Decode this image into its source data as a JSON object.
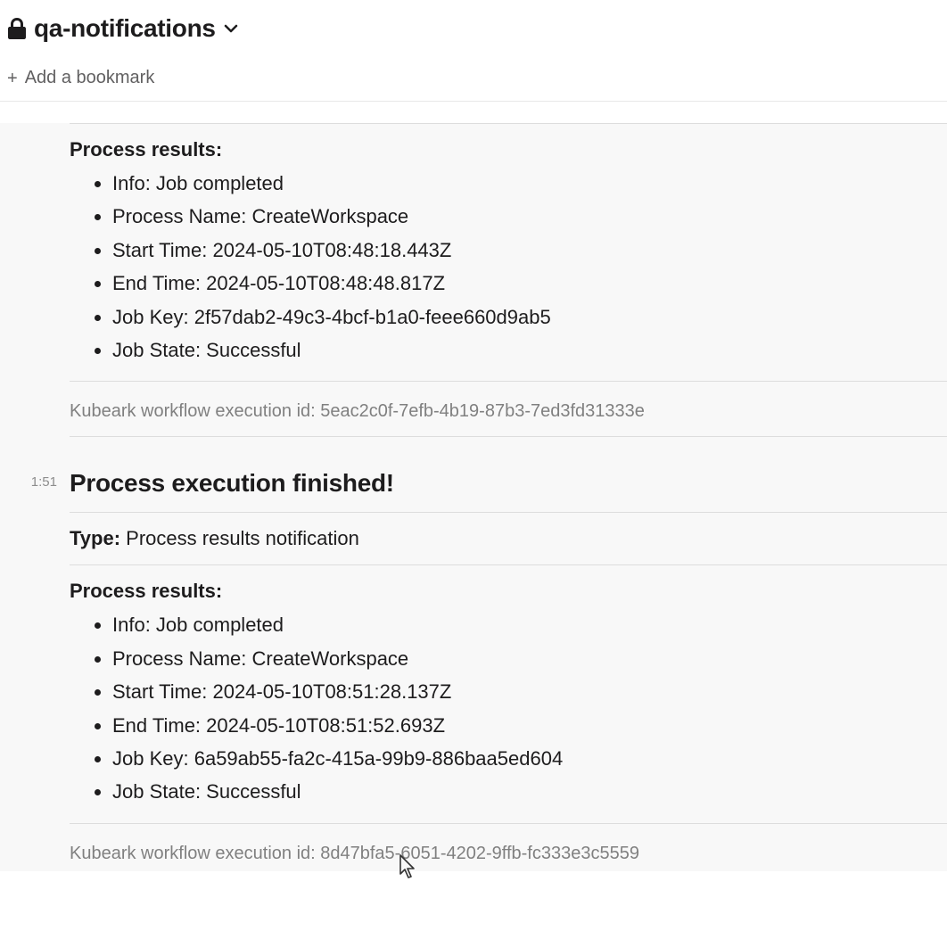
{
  "header": {
    "channel_name": "qa-notifications",
    "bookmark_text": "Add a bookmark"
  },
  "messages": [
    {
      "process_results_label": "Process results:",
      "items": [
        "Info: Job completed",
        "Process Name: CreateWorkspace",
        "Start Time: 2024-05-10T08:48:18.443Z",
        "End Time: 2024-05-10T08:48:48.817Z",
        "Job Key: 2f57dab2-49c3-4bcf-b1a0-feee660d9ab5",
        "Job State: Successful"
      ],
      "footer": "Kubeark workflow execution id: 5eac2c0f-7efb-4b19-87b3-7ed3fd31333e"
    },
    {
      "timestamp": "1:51",
      "heading": "Process execution finished!",
      "type_label": "Type:",
      "type_value": "Process results notification",
      "process_results_label": "Process results:",
      "items": [
        "Info: Job completed",
        "Process Name: CreateWorkspace",
        "Start Time: 2024-05-10T08:51:28.137Z",
        "End Time: 2024-05-10T08:51:52.693Z",
        "Job Key: 6a59ab55-fa2c-415a-99b9-886baa5ed604",
        "Job State: Successful"
      ],
      "footer": "Kubeark workflow execution id: 8d47bfa5-6051-4202-9ffb-fc333e3c5559"
    }
  ]
}
